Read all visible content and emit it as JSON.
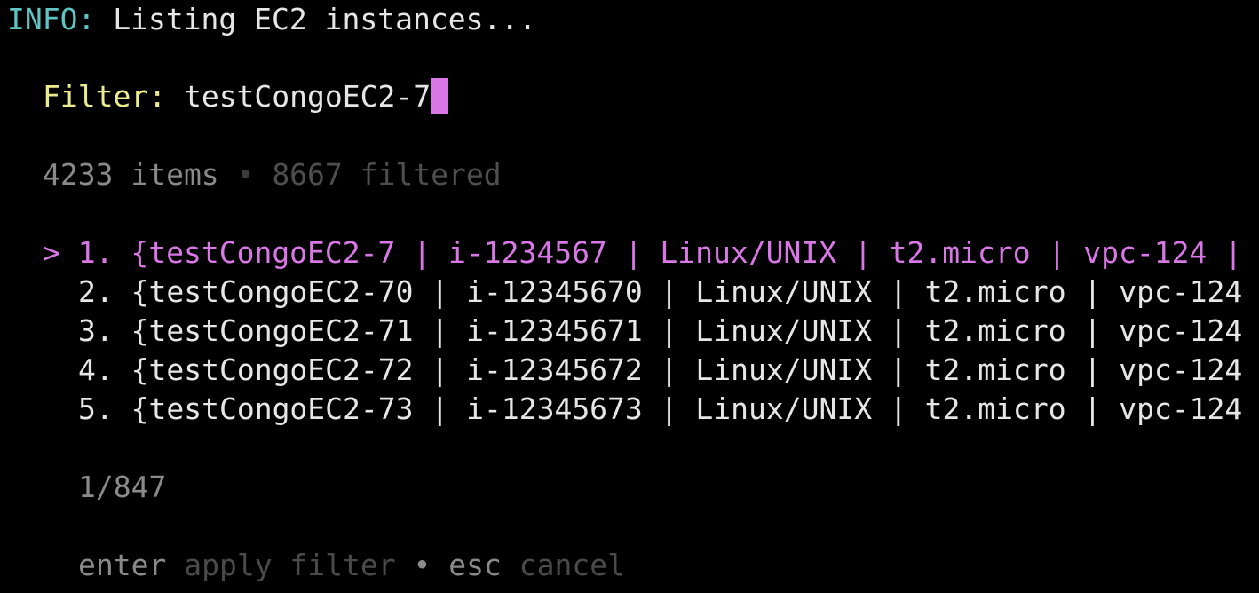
{
  "header": {
    "info_tag": "INFO:",
    "message": " Listing EC2 instances..."
  },
  "filter": {
    "label": "Filter:",
    "value": "testCongoEC2-7"
  },
  "counts": {
    "items": "4233 items",
    "separator": "•",
    "filtered": "8667 filtered"
  },
  "list": {
    "selected_marker": ">",
    "items": [
      {
        "number": "1.",
        "text": "{testCongoEC2-7 | i-1234567 | Linux/UNIX | t2.micro | vpc-124 |"
      },
      {
        "number": "2.",
        "text": "{testCongoEC2-70 | i-12345670 | Linux/UNIX | t2.micro | vpc-124"
      },
      {
        "number": "3.",
        "text": "{testCongoEC2-71 | i-12345671 | Linux/UNIX | t2.micro | vpc-124"
      },
      {
        "number": "4.",
        "text": "{testCongoEC2-72 | i-12345672 | Linux/UNIX | t2.micro | vpc-124"
      },
      {
        "number": "5.",
        "text": "{testCongoEC2-73 | i-12345673 | Linux/UNIX | t2.micro | vpc-124"
      }
    ]
  },
  "pagination": "1/847",
  "help": {
    "apply_key": "enter",
    "apply_desc": "apply filter",
    "separator": "•",
    "cancel_key": "esc",
    "cancel_desc": "cancel"
  },
  "colors": {
    "background": "#000000",
    "info": "#5ec4c4",
    "filter_label": "#ecec8e",
    "accent": "#d977e6"
  }
}
